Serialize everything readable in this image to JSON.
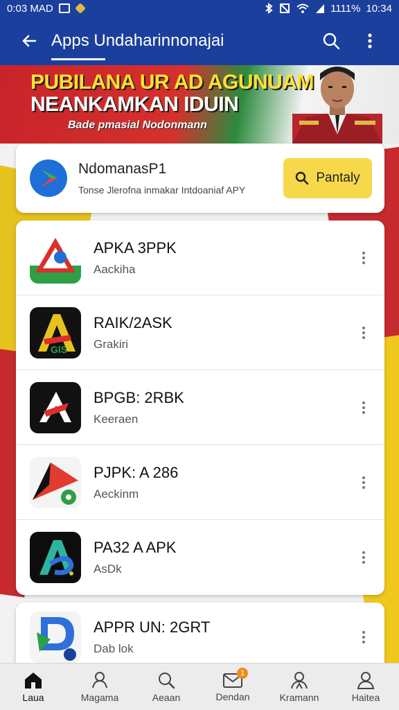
{
  "status_bar": {
    "left_text": "0:03 MAD",
    "right_text": "1111%",
    "time": "10:34"
  },
  "app_bar": {
    "title": "Apps Undaharinnonajai",
    "back_icon": "arrow-left-icon",
    "search_icon": "search-icon",
    "more_icon": "more-vertical-icon"
  },
  "banner": {
    "headline_line1": "PUBILANA UR AD AGUNUAM",
    "headline_line2": "NEANKAMKAN IDUIN",
    "tagline": "Bade pmasial Nodonmann"
  },
  "featured": {
    "name": "NdomanasP1",
    "description": "Tonse Jlerofna inmakar Intdoaniaf APY",
    "button_label": "Pantaly"
  },
  "apps": [
    {
      "name": "APKA 3PPK",
      "subtitle": "Aackiha"
    },
    {
      "name": "RAIK/2ASK",
      "subtitle": "Grakiri"
    },
    {
      "name": "BPGB: 2RBK",
      "subtitle": "Keeraen"
    },
    {
      "name": "PJPK: A 286",
      "subtitle": "Aeckinm"
    },
    {
      "name": "PA32 A APK",
      "subtitle": "AsDk"
    },
    {
      "name": "APPR UN: 2GRT",
      "subtitle": "Dab lok"
    }
  ],
  "bottom_nav": [
    {
      "label": "Laua",
      "icon": "home-icon",
      "active": true
    },
    {
      "label": "Magama",
      "icon": "apps-icon",
      "active": false
    },
    {
      "label": "Aeaan",
      "icon": "search-icon",
      "active": false
    },
    {
      "label": "Dendan",
      "icon": "mail-icon",
      "active": false,
      "badge": "1"
    },
    {
      "label": "Kramann",
      "icon": "community-icon",
      "active": false
    },
    {
      "label": "Haitea",
      "icon": "profile-icon",
      "active": false
    }
  ],
  "colors": {
    "primary": "#1b3f9c",
    "accent_yellow": "#f7d84a",
    "flag_red": "#c8232b",
    "badge_orange": "#f08c1a"
  }
}
